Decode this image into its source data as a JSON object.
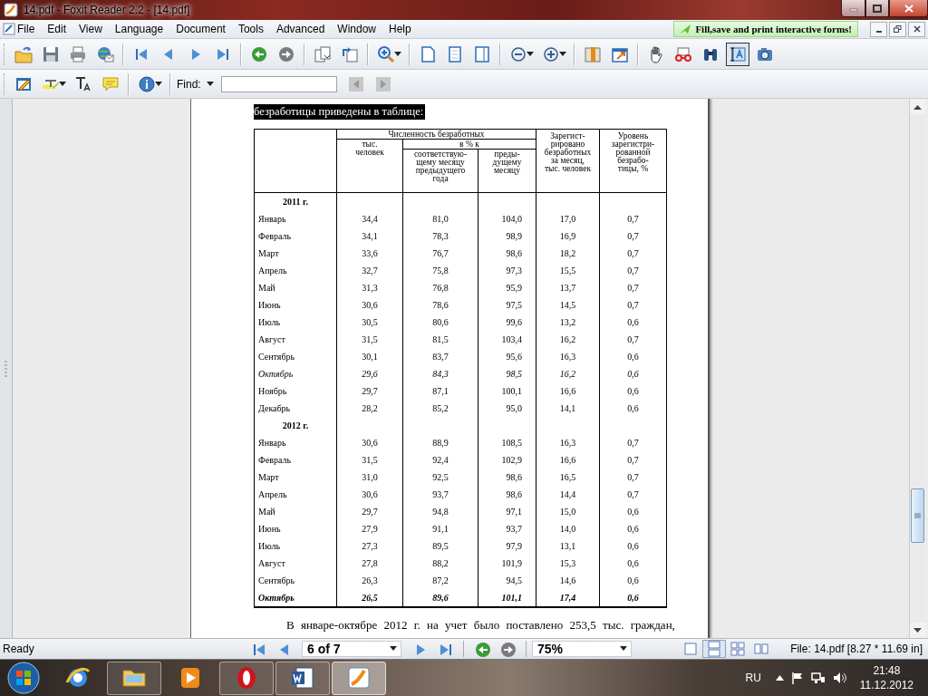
{
  "window": {
    "title": "14.pdf - Foxit Reader 2.2 - [14.pdf]"
  },
  "menu": [
    "File",
    "Edit",
    "View",
    "Language",
    "Document",
    "Tools",
    "Advanced",
    "Window",
    "Help"
  ],
  "promo": "Fill,save and print interactive forms!",
  "tools": [
    {
      "selected": false
    },
    {
      "selected": true
    },
    {
      "selected": false
    }
  ],
  "find": {
    "label": "Find:"
  },
  "document": {
    "intro": {
      "text": "безработицы приведены в таблице:",
      "selected": true
    },
    "table": {
      "header": {
        "group": "Численность безработных",
        "thousand": "тыс.\nчеловек",
        "percent": "в % к",
        "same_month": "соответствую-\nщему месяцу\nпредыдущего\nгода",
        "prev_month": "преды-\nдущему\nмесяцу",
        "registered": "Зарегист-\nрировано\nбезработных\nза месяц,\nтыс. человек",
        "rate": "Уровень\nзарегистри-\nрованной\nбезрабо-\nтицы, %"
      },
      "rows": [
        {
          "kind": "year",
          "label": "2011 г."
        },
        {
          "kind": "month",
          "label": "Январь",
          "cells": [
            "34,4",
            "81,0",
            "104,0",
            "17,0",
            "0,7"
          ]
        },
        {
          "kind": "month",
          "label": "Февраль",
          "cells": [
            "34,1",
            "78,3",
            "98,9",
            "16,9",
            "0,7"
          ]
        },
        {
          "kind": "month",
          "label": "Март",
          "cells": [
            "33,6",
            "76,7",
            "98,6",
            "18,2",
            "0,7"
          ]
        },
        {
          "kind": "month",
          "label": "Апрель",
          "cells": [
            "32,7",
            "75,8",
            "97,3",
            "15,5",
            "0,7"
          ]
        },
        {
          "kind": "month",
          "label": "Май",
          "cells": [
            "31,3",
            "76,8",
            "95,9",
            "13,7",
            "0,7"
          ]
        },
        {
          "kind": "month",
          "label": "Июнь",
          "cells": [
            "30,6",
            "78,6",
            "97,5",
            "14,5",
            "0,7"
          ]
        },
        {
          "kind": "month",
          "label": "Июль",
          "cells": [
            "30,5",
            "80,6",
            "99,6",
            "13,2",
            "0,6"
          ]
        },
        {
          "kind": "month",
          "label": "Август",
          "cells": [
            "31,5",
            "81,5",
            "103,4",
            "16,2",
            "0,7"
          ]
        },
        {
          "kind": "month",
          "label": "Сентябрь",
          "cells": [
            "30,1",
            "83,7",
            "95,6",
            "16,3",
            "0,6"
          ]
        },
        {
          "kind": "italic-month",
          "label": "Октябрь",
          "cells": [
            "29,6",
            "84,3",
            "98,5",
            "16,2",
            "0,6"
          ]
        },
        {
          "kind": "month",
          "label": "Ноябрь",
          "cells": [
            "29,7",
            "87,1",
            "100,1",
            "16,6",
            "0,6"
          ]
        },
        {
          "kind": "month",
          "label": "Декабрь",
          "cells": [
            "28,2",
            "85,2",
            "95,0",
            "14,1",
            "0,6"
          ]
        },
        {
          "kind": "year",
          "label": "2012 г."
        },
        {
          "kind": "month",
          "label": "Январь",
          "cells": [
            "30,6",
            "88,9",
            "108,5",
            "16,3",
            "0,7"
          ]
        },
        {
          "kind": "month",
          "label": "Февраль",
          "cells": [
            "31,5",
            "92,4",
            "102,9",
            "16,6",
            "0,7"
          ]
        },
        {
          "kind": "month",
          "label": "Март",
          "cells": [
            "31,0",
            "92,5",
            "98,6",
            "16,5",
            "0,7"
          ]
        },
        {
          "kind": "month",
          "label": "Апрель",
          "cells": [
            "30,6",
            "93,7",
            "98,6",
            "14,4",
            "0,7"
          ]
        },
        {
          "kind": "month",
          "label": "Май",
          "cells": [
            "29,7",
            "94,8",
            "97,1",
            "15,0",
            "0,6"
          ]
        },
        {
          "kind": "month",
          "label": "Июнь",
          "cells": [
            "27,9",
            "91,1",
            "93,7",
            "14,0",
            "0,6"
          ]
        },
        {
          "kind": "month",
          "label": "Июль",
          "cells": [
            "27,3",
            "89,5",
            "97,9",
            "13,1",
            "0,6"
          ]
        },
        {
          "kind": "month",
          "label": "Август",
          "cells": [
            "27,8",
            "88,2",
            "101,9",
            "15,3",
            "0,6"
          ]
        },
        {
          "kind": "month",
          "label": "Сентябрь",
          "cells": [
            "26,3",
            "87,2",
            "94,5",
            "14,6",
            "0,6"
          ]
        },
        {
          "kind": "bold-month",
          "label": "Октябрь",
          "cells": [
            "26,5",
            "89,6",
            "101,1",
            "17,4",
            "0,6"
          ]
        }
      ]
    },
    "paragraph": "В январе-октябре 2012 г. на учет было поставлено 253,5 тыс. граждан,"
  },
  "status": {
    "text": "Ready",
    "page": "6 of 7",
    "zoom": "75%",
    "view_modes": [
      {
        "selected": false
      },
      {
        "selected": true
      },
      {
        "selected": false
      },
      {
        "selected": false
      }
    ],
    "file_info": "File: 14.pdf [8.27 * 11.69 in]"
  },
  "taskbar": {
    "apps": [
      {
        "running": false,
        "selected": false
      },
      {
        "running": true,
        "selected": false
      },
      {
        "running": false,
        "selected": false
      },
      {
        "running": true,
        "selected": false
      },
      {
        "running": true,
        "selected": false
      },
      {
        "running": true,
        "selected": true
      }
    ],
    "language": "RU",
    "time": "21:48",
    "date": "11.12.2012"
  }
}
